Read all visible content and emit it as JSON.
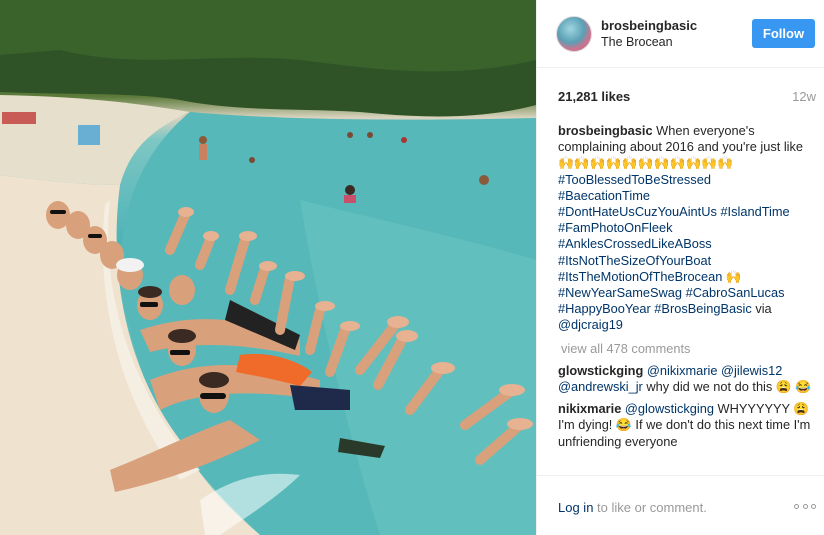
{
  "post": {
    "username": "brosbeingbasic",
    "location": "The Brocean",
    "follow_label": "Follow",
    "likes": "21,281 likes",
    "age": "12w"
  },
  "caption": {
    "user": "brosbeingbasic",
    "text": "When everyone's complaining about 2016 and you're just like 🙌🙌🙌🙌🙌🙌🙌🙌🙌🙌🙌",
    "tags": [
      "#TooBlessedToBeStressed",
      "#BaecationTime",
      "#DontHateUsCuzYouAintUs",
      "#IslandTime",
      "#FamPhotoOnFleek",
      "#AnklesCrossedLikeABoss",
      "#ItsNotTheSizeOfYourBoat",
      "#ItsTheMotionOfTheBrocean",
      "#NewYearSameSwag",
      "#CabroSanLucas",
      "#HappyBooYear",
      "#BrosBeingBasic"
    ],
    "emoji_after_brocean": "🙌",
    "via": "via",
    "via_user": "@djcraig19"
  },
  "view_all": "view all 478 comments",
  "comments": [
    {
      "user": "glowstickging",
      "mention1": "@nikixmarie",
      "mention2": "@jilewis12",
      "mention3": "@andrewski_jr",
      "text": "why did we not do this 😩 😂"
    },
    {
      "user": "nikixmarie",
      "mention1": "@glowstickging",
      "text": "WHYYYYYY 😩 I'm dying! 😂 If we don't do this next time I'm unfriending everyone"
    }
  ],
  "footer": {
    "login": "Log in",
    "rest": " to like or comment."
  },
  "colors": {
    "follow": "#3897f0",
    "link": "#003569",
    "muted": "#999999"
  }
}
